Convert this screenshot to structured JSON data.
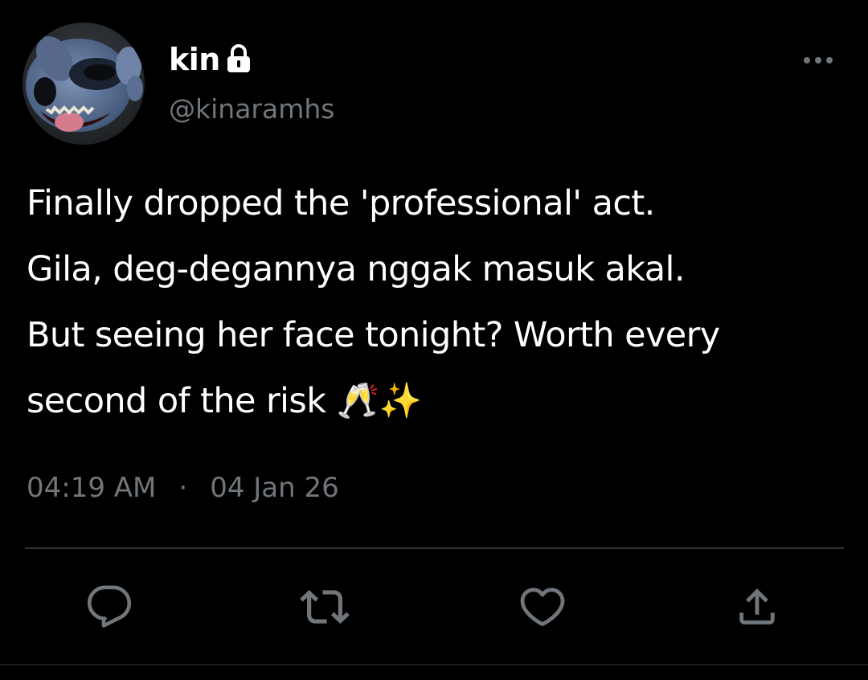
{
  "user": {
    "display_name": "kin",
    "handle": "@kinaramhs",
    "protected_icon": "lock-icon",
    "avatar": "stitch-avatar"
  },
  "menu": {
    "icon": "more-horizontal-icon"
  },
  "tweet": {
    "lines": [
      "Finally dropped the 'professional' act.",
      "Gila, deg-degannya nggak masuk akal.",
      "But seeing her face tonight? Worth every",
      "second of the risk 🥂✨"
    ],
    "time": "04:19 AM",
    "separator": "·",
    "date": "04 Jan 26"
  },
  "actions": [
    {
      "name": "reply",
      "icon": "reply-bubble-icon"
    },
    {
      "name": "retweet",
      "icon": "retweet-icon"
    },
    {
      "name": "like",
      "icon": "heart-icon"
    },
    {
      "name": "share",
      "icon": "share-upload-icon"
    }
  ],
  "colors": {
    "background": "#000000",
    "text_primary": "#ffffff",
    "text_secondary": "#71767b",
    "divider": "#2f3336"
  }
}
